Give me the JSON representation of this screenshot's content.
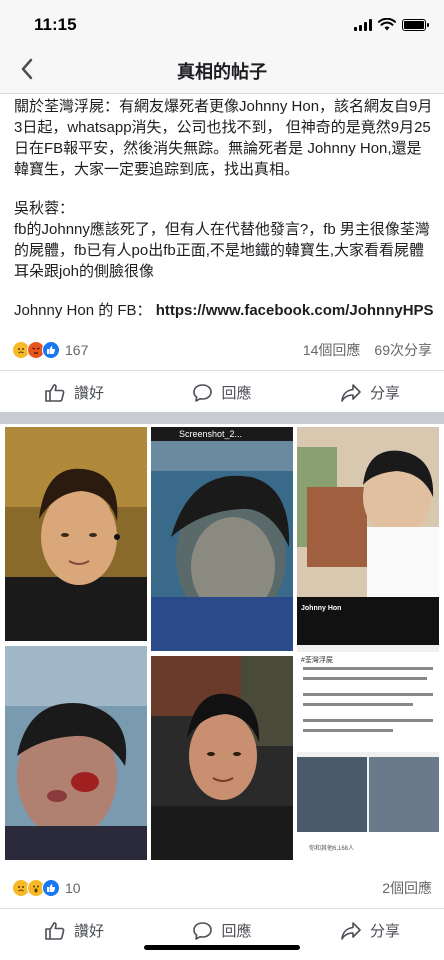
{
  "status_bar": {
    "time": "11:15"
  },
  "nav": {
    "title": "真相的帖子"
  },
  "post": {
    "paragraph1": "關於荃灣浮屍：有網友爆死者更像Johnny Hon，該名網友自9月3日起，whatsapp消失，公司也找不到， 但神奇的是竟然9月25日在FB報平安，然後消失無踪。無論死者是 Johnny Hon,還是韓寶生，大家一定要追踪到底，找出真相。",
    "paragraph2_author": "吳秋蓉：",
    "paragraph2": "fb的Johnny應該死了，但有人在代替他發言?，fb 男主很像荃灣的屍體，fb已有人po出fb正面,不是地鐵的韓寶生,大家看看屍體耳朵跟joh的側臉很像",
    "fb_label": "Johnny Hon 的 FB：",
    "fb_link": "https://www.facebook.com/JohnnyHPS"
  },
  "stats1": {
    "reaction_count": "167",
    "comments": "14個回應",
    "shares": "69次分享"
  },
  "actions": {
    "like": "讚好",
    "comment": "回應",
    "share": "分享"
  },
  "photos": {
    "screenshot_bar": "Screenshot_2...",
    "fb_card_name": "Johnny Hon",
    "fb_card_tag": "#荃灣浮屍",
    "fb_card_likes": "你和其他6,168人"
  },
  "stats2": {
    "reaction_count": "10",
    "comments": "2個回應"
  },
  "colors": {
    "accent": "#1877f2",
    "separator": "#c9ccd1",
    "nav_bg": "#f7f7f7"
  }
}
